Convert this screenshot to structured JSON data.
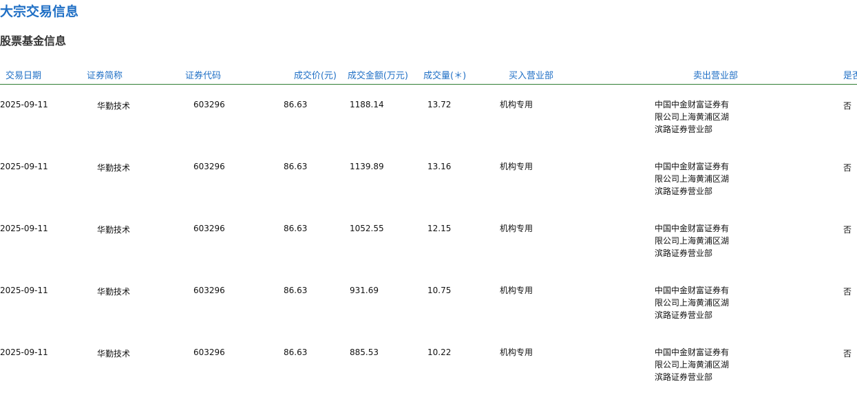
{
  "page": {
    "title": "大宗交易信息",
    "section": "股票基金信息"
  },
  "table": {
    "headers": {
      "date": "交易日期",
      "name": "证券简称",
      "code": "证券代码",
      "price": "成交价(元)",
      "amount": "成交金额(万元)",
      "volume": "成交量(＊)",
      "buy": "买入营业部",
      "sell": "卖出营业部",
      "flag": "是否为专场"
    },
    "rows": [
      {
        "date": "2025-09-11",
        "name": "华勤技术",
        "code": "603296",
        "price": "86.63",
        "amount": "1188.14",
        "volume": "13.72",
        "buy": "机构专用",
        "sell": "中国中金财富证券有限公司上海黄浦区湖滨路证券营业部",
        "flag": "否"
      },
      {
        "date": "2025-09-11",
        "name": "华勤技术",
        "code": "603296",
        "price": "86.63",
        "amount": "1139.89",
        "volume": "13.16",
        "buy": "机构专用",
        "sell": "中国中金财富证券有限公司上海黄浦区湖滨路证券营业部",
        "flag": "否"
      },
      {
        "date": "2025-09-11",
        "name": "华勤技术",
        "code": "603296",
        "price": "86.63",
        "amount": "1052.55",
        "volume": "12.15",
        "buy": "机构专用",
        "sell": "中国中金财富证券有限公司上海黄浦区湖滨路证券营业部",
        "flag": "否"
      },
      {
        "date": "2025-09-11",
        "name": "华勤技术",
        "code": "603296",
        "price": "86.63",
        "amount": "931.69",
        "volume": "10.75",
        "buy": "机构专用",
        "sell": "中国中金财富证券有限公司上海黄浦区湖滨路证券营业部",
        "flag": "否"
      },
      {
        "date": "2025-09-11",
        "name": "华勤技术",
        "code": "603296",
        "price": "86.63",
        "amount": "885.53",
        "volume": "10.22",
        "buy": "机构专用",
        "sell": "中国中金财富证券有限公司上海黄浦区湖滨路证券营业部",
        "flag": "否"
      }
    ]
  },
  "colors": {
    "accent": "#1f6fc5",
    "header_rule": "#2e7d32"
  }
}
